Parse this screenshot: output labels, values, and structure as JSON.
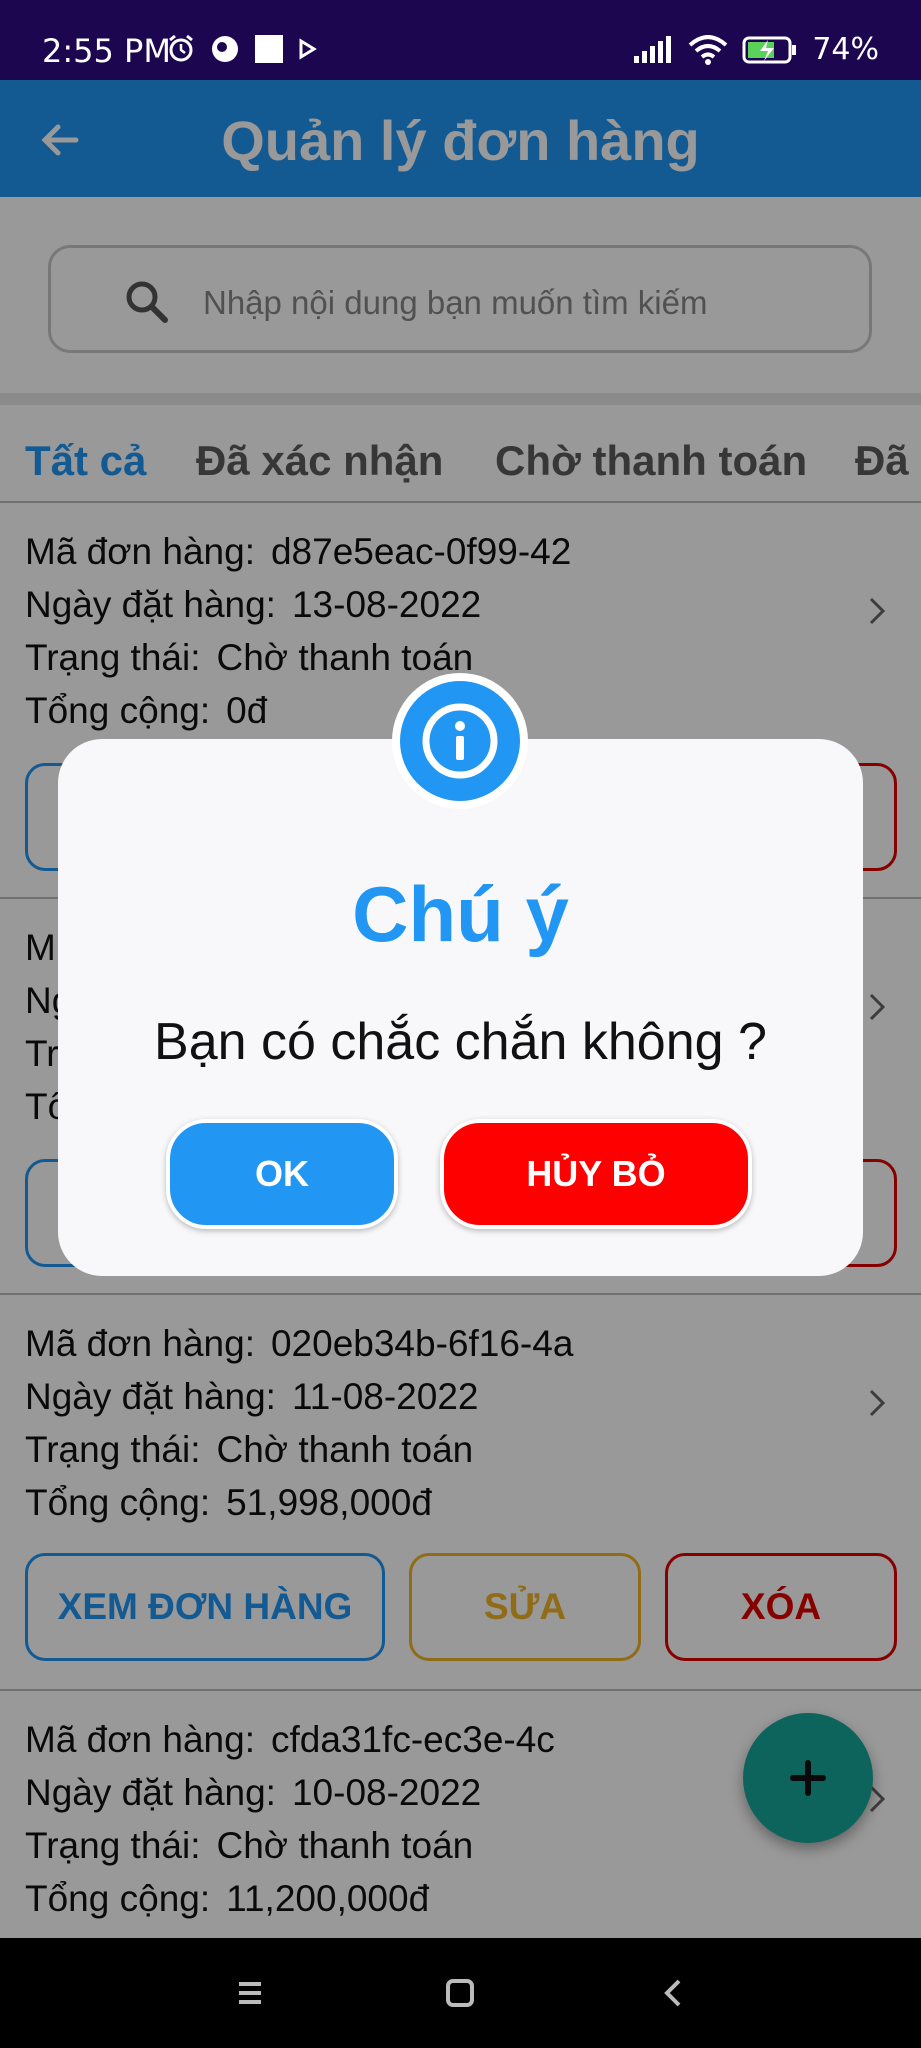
{
  "status_bar": {
    "time": "2:55 PM",
    "battery": "74%",
    "left_icons": [
      "alarm-icon",
      "app-notification-icon",
      "square-notification-icon",
      "play-icon"
    ],
    "right_icons": [
      "signal-icon",
      "wifi-icon",
      "battery-charging-icon"
    ]
  },
  "app_bar": {
    "title": "Quản lý đơn hàng",
    "back_icon": "arrow-left-icon"
  },
  "search": {
    "placeholder": "Nhập nội dung bạn muốn tìm kiếm"
  },
  "tabs": [
    {
      "label": "Tất cả",
      "active": true
    },
    {
      "label": "Đã xác nhận",
      "active": false
    },
    {
      "label": "Chờ thanh toán",
      "active": false
    },
    {
      "label": "Đã",
      "active": false
    }
  ],
  "order_labels": {
    "id": "Mã đơn hàng:",
    "date": "Ngày đặt hàng:",
    "status": "Trạng thái:",
    "total": "Tổng cộng:"
  },
  "order_buttons": {
    "view": "XEM ĐƠN HÀNG",
    "edit": "SỬA",
    "delete": "XÓA"
  },
  "orders": [
    {
      "id": "d87e5eac-0f99-42",
      "date": "13-08-2022",
      "status": "Chờ thanh toán",
      "total": "0đ"
    },
    {
      "id": "",
      "date": "",
      "status": "",
      "total": ""
    },
    {
      "id": "020eb34b-6f16-4a",
      "date": "11-08-2022",
      "status": "Chờ thanh toán",
      "total": "51,998,000đ"
    },
    {
      "id": "cfda31fc-ec3e-4c",
      "date": "10-08-2022",
      "status": "Chờ thanh toán",
      "total": "11,200,000đ"
    }
  ],
  "fab": {
    "icon": "plus-icon"
  },
  "dialog": {
    "icon": "info-icon",
    "title": "Chú ý",
    "message": "Bạn có chắc chắn không ?",
    "ok_label": "OK",
    "cancel_label": "HỦY BỎ"
  },
  "colors": {
    "primary": "#2196f3",
    "danger": "#ff0000",
    "warning": "#f0b429",
    "fab": "#17a79a",
    "status_bar": "#1c0650"
  }
}
